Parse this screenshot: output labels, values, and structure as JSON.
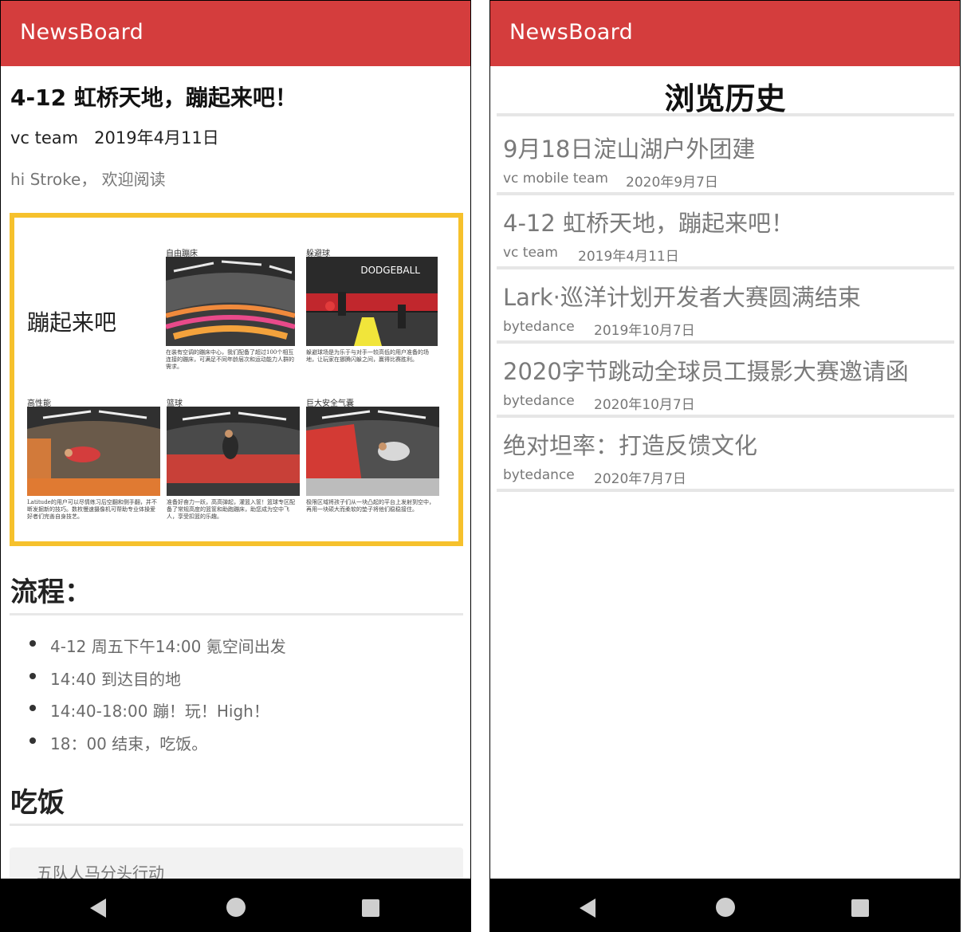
{
  "left": {
    "app_title": "NewsBoard",
    "article": {
      "title": "4-12 虹桥天地，蹦起来吧！",
      "author": "vc team",
      "date": "2019年4月11日",
      "greeting": "hi Stroke， 欢迎阅读",
      "poster": {
        "headline": "蹦起来吧",
        "panels": [
          {
            "label": "自由蹦床",
            "caption": "在装有空调的蹦床中心，我们配备了超过100个相互连接的蹦床，可满足不同年龄层次和运动能力人群的需求。"
          },
          {
            "label": "躲避球",
            "caption": "躲避球场是为乐于与对手一较高低的用户准备的场地，让玩家在挪腾闪躲之间，赢得比赛胜利。",
            "sign": "DODGEBALL"
          },
          {
            "label": "高性能",
            "caption": "Latitude的用户可以尽情练习后空翻和侧手翻，并不断发掘新的技巧。数枚慢速摄像机可帮助专业体操爱好者们完善自身技艺。"
          },
          {
            "label": "篮球",
            "caption": "准备好奋力一跃，高高弹起，灌篮入筐！篮球专区配备了常规高度的篮筐和助跑蹦床，助您成为空中飞人，享受扣篮的乐趣。"
          },
          {
            "label": "巨大安全气囊",
            "caption": "极限区域将孩子们从一块凸起的平台上发射到空中，再用一块硕大而柔软的垫子将他们稳稳接住。"
          }
        ]
      },
      "section_flow": "流程：",
      "flow_items": [
        "4-12 周五下午14:00 氪空间出发",
        "14:40 到达目的地",
        "14:40-18:00 蹦！玩！High！",
        "18：00 结束，吃饭。"
      ],
      "section_meal": "吃饭",
      "quote": "五队人马分头行动"
    }
  },
  "right": {
    "app_title": "NewsBoard",
    "page_title": "浏览历史",
    "history": [
      {
        "title": "9月18日淀山湖户外团建",
        "author": "vc mobile team",
        "date": "2020年9月7日"
      },
      {
        "title": "4-12 虹桥天地，蹦起来吧！",
        "author": "vc team",
        "date": "2019年4月11日"
      },
      {
        "title": "Lark·巡洋计划开发者大赛圆满结束",
        "author": "bytedance",
        "date": "2019年10月7日"
      },
      {
        "title": "2020字节跳动全球员工摄影大赛邀请函",
        "author": "bytedance",
        "date": "2020年10月7日"
      },
      {
        "title": "绝对坦率：打造反馈文化",
        "author": "bytedance",
        "date": "2020年7月7日"
      }
    ]
  },
  "colors": {
    "appbar": "#d43d3d",
    "poster_border": "#f6c12c",
    "navbar": "#000000"
  },
  "icons": [
    "back-triangle-icon",
    "home-circle-icon",
    "recents-square-icon"
  ]
}
